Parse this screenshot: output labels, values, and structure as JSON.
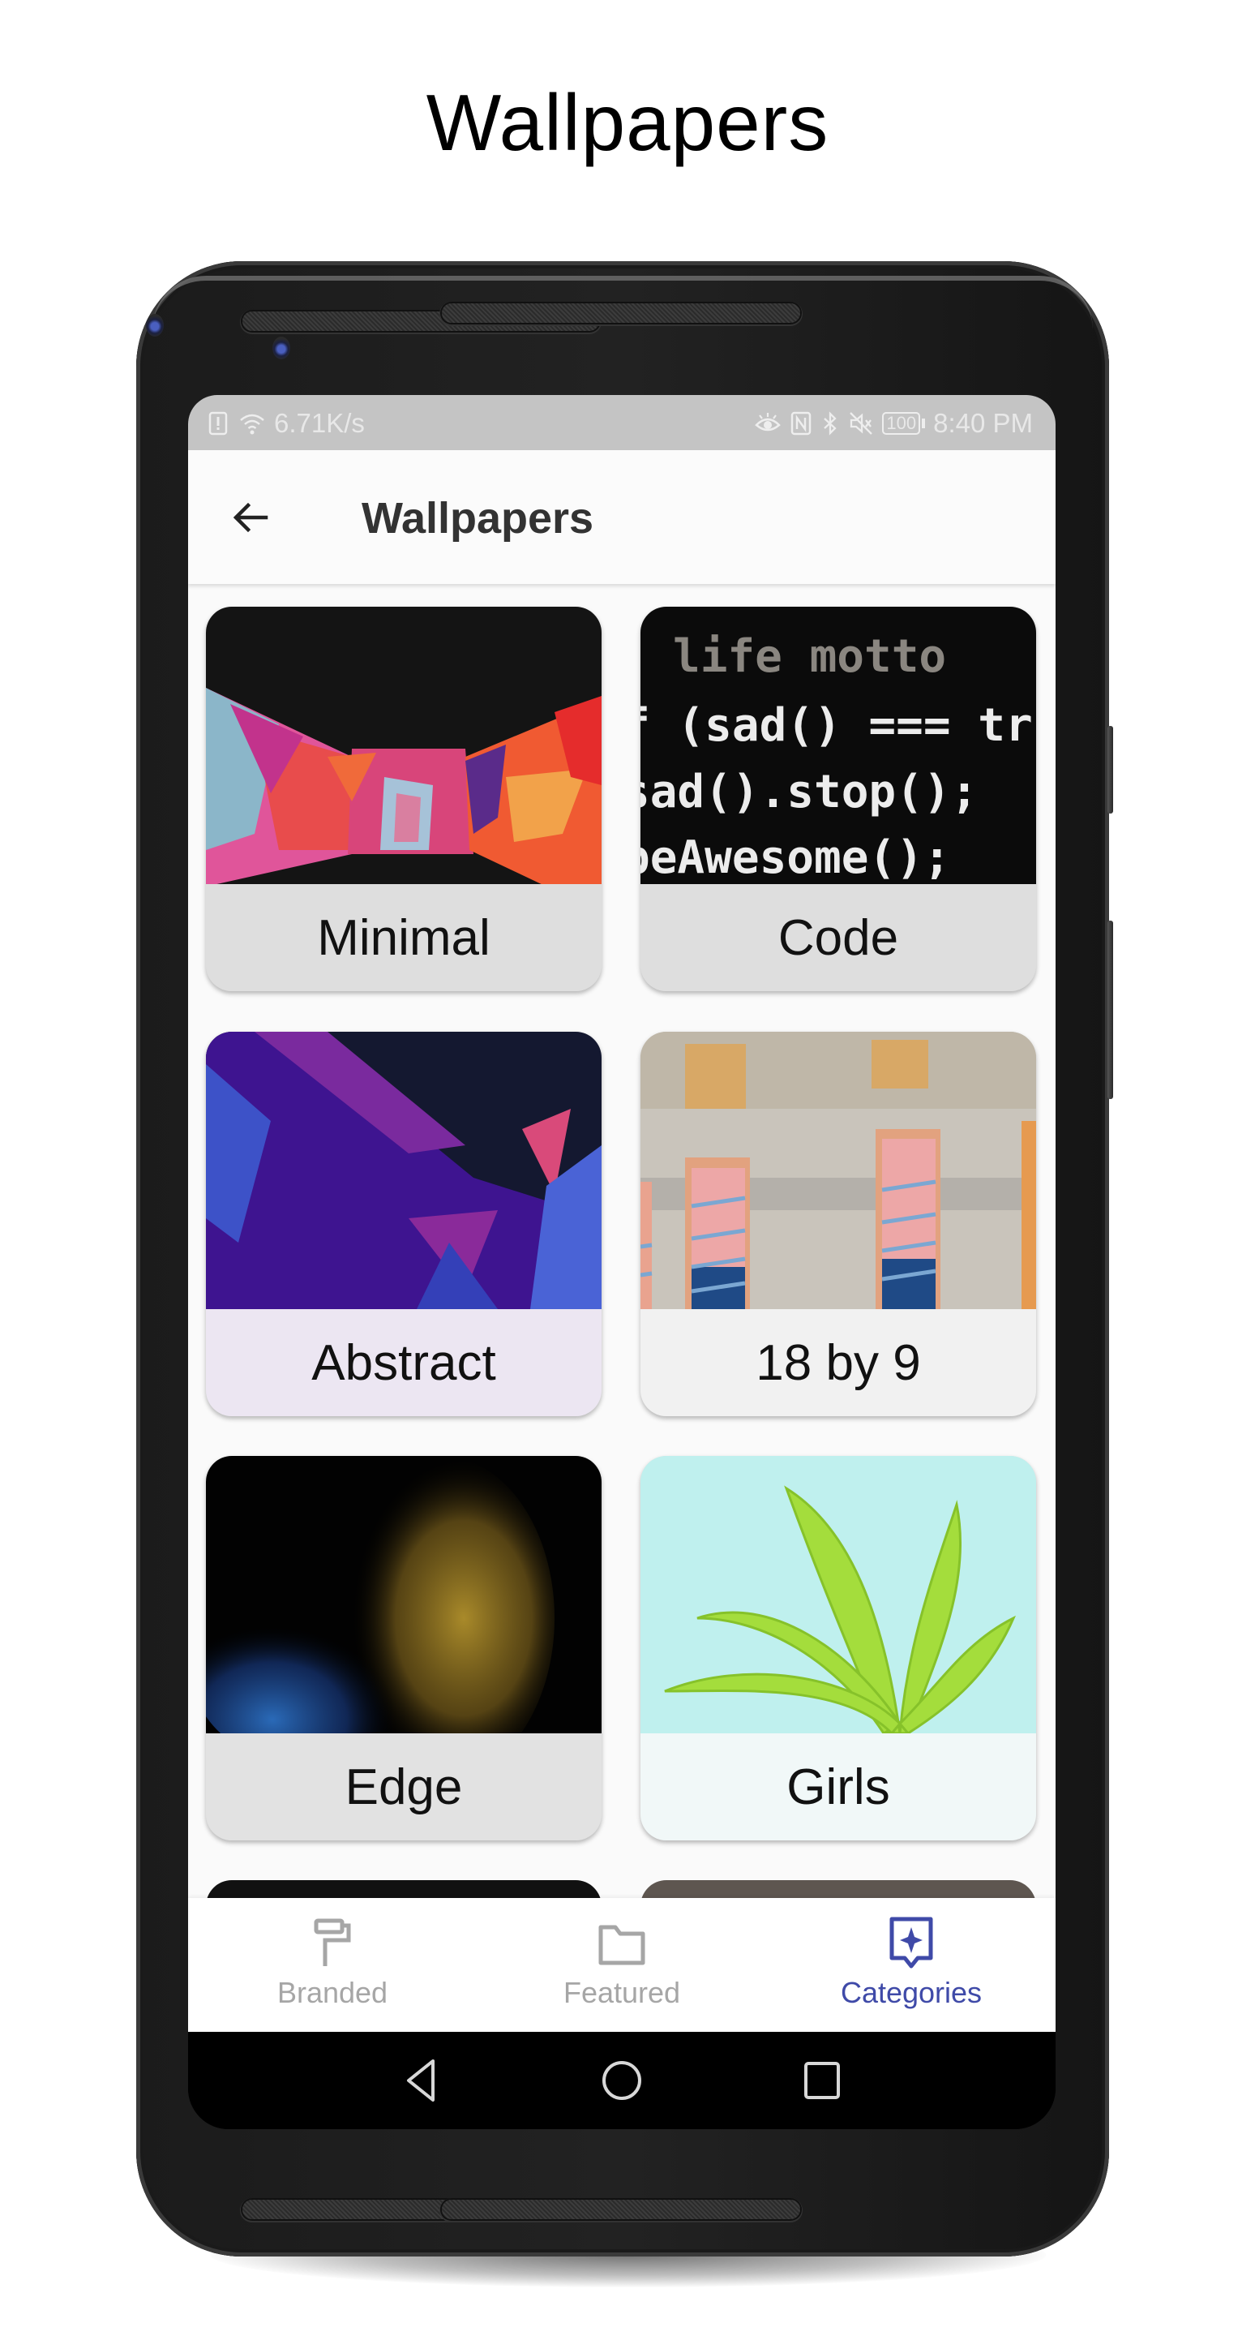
{
  "promo": {
    "title": "Wallpapers"
  },
  "status_bar": {
    "left_icons": [
      "sim-alert-icon",
      "wifi-icon"
    ],
    "network_speed": "6.71K/s",
    "right_icons": [
      "eye-comfort-icon",
      "nfc-icon",
      "bluetooth-icon",
      "mute-icon",
      "battery-icon"
    ],
    "battery_level": "100",
    "time": "8:40 PM"
  },
  "app_bar": {
    "back_icon": "arrow-back-icon",
    "title": "Wallpapers"
  },
  "categories": [
    {
      "label": "Minimal",
      "thumb": "colorful-bowtie-abstract"
    },
    {
      "label": "Code",
      "thumb": "code-text-dark",
      "code_lines": [
        "// life motto",
        "if (sad() === true) {",
        "  sad().stop();",
        "  beAwesome();"
      ]
    },
    {
      "label": "Abstract",
      "thumb": "purple-polygon"
    },
    {
      "label": "18 by 9",
      "thumb": "building-windows"
    },
    {
      "label": "Edge",
      "thumb": "gold-blue-powder"
    },
    {
      "label": "Girls",
      "thumb": "palm-tree"
    }
  ],
  "bottom_nav": {
    "active_color": "#3f4aa8",
    "inactive_color": "#a6a6a6",
    "items": [
      {
        "label": "Branded",
        "icon": "paint-roller-icon",
        "active": false
      },
      {
        "label": "Featured",
        "icon": "folder-icon",
        "active": false
      },
      {
        "label": "Categories",
        "icon": "sparkle-badge-icon",
        "active": true
      }
    ]
  },
  "system_nav": {
    "buttons": [
      "back-triangle-icon",
      "home-circle-icon",
      "recents-square-icon"
    ]
  }
}
